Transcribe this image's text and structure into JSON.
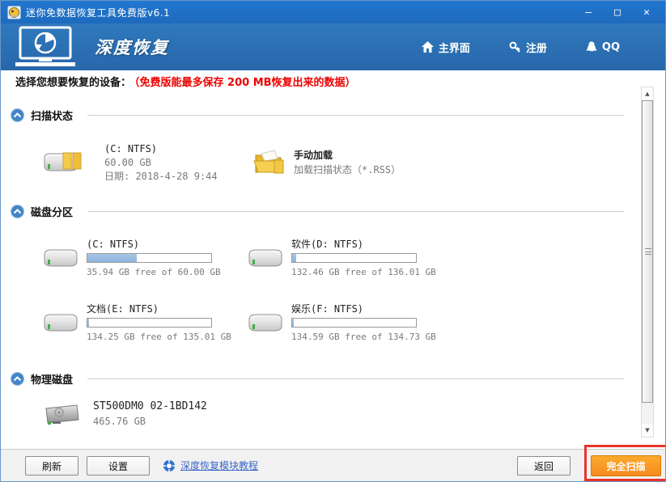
{
  "window": {
    "title": "迷你免数据恢复工具免费版v6.1"
  },
  "header": {
    "title": "深度恢复",
    "nav": [
      {
        "label": "主界面",
        "icon": "home-icon"
      },
      {
        "label": "注册",
        "icon": "key-icon"
      },
      {
        "label": "QQ",
        "icon": "qq-icon"
      }
    ]
  },
  "notice": {
    "label": "选择您想要恢复的设备：",
    "warning": "（免费版能最多保存 200 MB恢复出来的数据）"
  },
  "sections": {
    "scan_status": {
      "title": "扫描状态",
      "drive": {
        "name": "(C: NTFS)",
        "size": "60.00 GB",
        "date": "日期: 2018-4-28 9:44"
      },
      "manual": {
        "title": "手动加载",
        "desc": "加载扫描状态（*.RSS）"
      }
    },
    "partitions": {
      "title": "磁盘分区",
      "items": [
        {
          "name": "(C: NTFS)",
          "free": "35.94 GB free of 60.00 GB",
          "used_percent": 40
        },
        {
          "name": "软件(D: NTFS)",
          "free": "132.46 GB free of 136.01 GB",
          "used_percent": 3
        },
        {
          "name": "文档(E: NTFS)",
          "free": "134.25 GB free of 135.01 GB",
          "used_percent": 1.5
        },
        {
          "name": "娱乐(F: NTFS)",
          "free": "134.59 GB free of 134.73 GB",
          "used_percent": 1
        }
      ]
    },
    "physical": {
      "title": "物理磁盘",
      "items": [
        {
          "name": "ST500DM0 02-1BD142",
          "size": "465.76 GB"
        }
      ]
    }
  },
  "footer": {
    "refresh": "刷新",
    "settings": "设置",
    "tutorial": "深度恢复模块教程",
    "back": "返回",
    "full_scan": "完全扫描"
  },
  "icons": {
    "home": "home-icon",
    "key": "key-icon",
    "qq": "qq-icon",
    "collapse": "chevron-up-circle-icon",
    "help": "life-ring-icon"
  },
  "colors": {
    "titlebar": "#1d6abd",
    "header": "#2b6fb3",
    "accent_orange": "#f7941e",
    "warning_red": "#ee0000",
    "link_blue": "#3a66c8",
    "annotation_red": "#e8332a",
    "bar_fill": "#8db3dc"
  }
}
